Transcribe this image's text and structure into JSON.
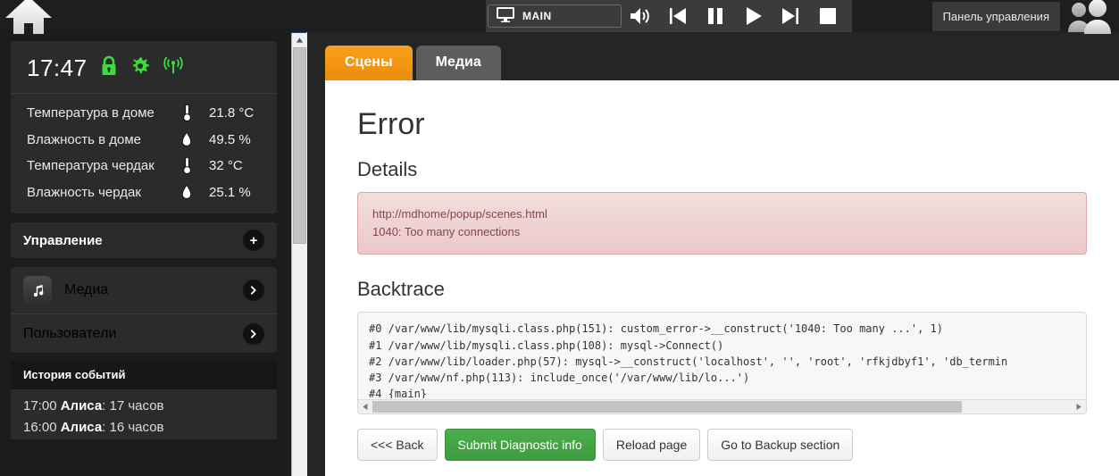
{
  "topbar": {
    "home_icon": "home-icon",
    "screen_selector": {
      "icon": "monitor-icon",
      "label": "MAIN"
    },
    "controls": [
      {
        "name": "volume-icon",
        "glyph": "volume"
      },
      {
        "name": "previous-icon",
        "glyph": "previous"
      },
      {
        "name": "pause-icon",
        "glyph": "pause"
      },
      {
        "name": "play-icon",
        "glyph": "play"
      },
      {
        "name": "next-icon",
        "glyph": "next"
      },
      {
        "name": "stop-icon",
        "glyph": "stop"
      }
    ],
    "control_panel_label": "Панель управления",
    "avatar_icon": "users-avatar-icon"
  },
  "sidebar": {
    "clock": "17:47",
    "status_icons": [
      {
        "name": "lock-icon",
        "color": "#3ddc3d"
      },
      {
        "name": "gear-icon",
        "color": "#3ddc3d"
      },
      {
        "name": "wifi-signal-icon",
        "color": "#3ddc3d"
      }
    ],
    "sensors": [
      {
        "label": "Температура в доме",
        "icon": "thermometer-icon",
        "value": "21.8 °C"
      },
      {
        "label": "Влажность в доме",
        "icon": "water-drop-icon",
        "value": "49.5 %"
      },
      {
        "label": "Температура чердак",
        "icon": "thermometer-icon",
        "value": "32 °C"
      },
      {
        "label": "Влажность чердак",
        "icon": "water-drop-icon",
        "value": "25.1 %"
      }
    ],
    "control_section": {
      "title": "Управление",
      "add_icon": "plus-icon"
    },
    "media_section": {
      "title": "Медиа",
      "icon": "music-note-icon",
      "chevron": "chevron-right-icon"
    },
    "users_section": {
      "title": "Пользователи",
      "chevron": "chevron-right-icon"
    },
    "history_title": "История событий",
    "history_items": [
      {
        "time": "17:00",
        "user": "Алиса",
        "text": "17 часов"
      },
      {
        "time": "16:00",
        "user": "Алиса",
        "text": "16 часов"
      }
    ]
  },
  "frame": {
    "corner_icon": "new-window-icon",
    "scroll_up_icon": "scroll-up-arrow-icon"
  },
  "main": {
    "tabs": [
      {
        "label": "Сцены",
        "active": true
      },
      {
        "label": "Медиа",
        "active": false
      }
    ],
    "error_title": "Error",
    "details_heading": "Details",
    "details_lines": [
      "http://mdhome/popup/scenes.html",
      "1040: Too many connections"
    ],
    "backtrace_heading": "Backtrace",
    "backtrace": "#0 /var/www/lib/mysqli.class.php(151): custom_error->__construct('1040: Too many ...', 1)\n#1 /var/www/lib/mysqli.class.php(108): mysql->Connect()\n#2 /var/www/lib/loader.php(57): mysql->__construct('localhost', '', 'root', 'rfkjdbyf1', 'db_termin\n#3 /var/www/nf.php(113): include_once('/var/www/lib/lo...')\n#4 {main}",
    "scroll_left_icon": "scroll-left-arrow-icon",
    "scroll_right_icon": "scroll-right-arrow-icon",
    "buttons": [
      {
        "label": "<<< Back",
        "style": "default"
      },
      {
        "label": "Submit Diagnostic info",
        "style": "green"
      },
      {
        "label": "Reload page",
        "style": "default"
      },
      {
        "label": "Go to Backup section",
        "style": "default"
      }
    ]
  },
  "colors": {
    "accent_orange": "#ed8c09",
    "status_green": "#3ddc3d",
    "error_bg": "#f2dede",
    "error_text": "#8a4444",
    "submit_green": "#3d9c3d"
  }
}
